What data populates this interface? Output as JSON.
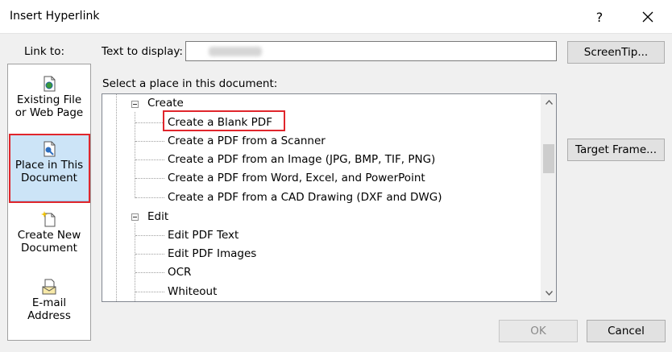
{
  "window": {
    "title": "Insert Hyperlink",
    "help_label": "?"
  },
  "link_to": {
    "label": "Link to:",
    "items": [
      {
        "label_line1": "Existing File",
        "label_line2": "or Web Page",
        "icon": "web-page-icon"
      },
      {
        "label_line1": "Place in This",
        "label_line2": "Document",
        "icon": "place-in-document-icon",
        "selected": true
      },
      {
        "label_line1": "Create New",
        "label_line2": "Document",
        "icon": "new-document-icon"
      },
      {
        "label_line1": "E-mail",
        "label_line2": "Address",
        "icon": "email-address-icon"
      }
    ]
  },
  "text_to_display": {
    "label": "Text to display:",
    "value": ""
  },
  "buttons": {
    "screentip": "ScreenTip...",
    "target_frame": "Target Frame...",
    "ok": "OK",
    "cancel": "Cancel"
  },
  "place": {
    "label": "Select a place in this document:",
    "tree": [
      {
        "text": "Create",
        "level": 0,
        "expanded": true
      },
      {
        "text": "Create a Blank PDF",
        "level": 1,
        "highlighted": true
      },
      {
        "text": "Create a PDF from a Scanner",
        "level": 1
      },
      {
        "text": "Create a PDF from an Image (JPG, BMP, TIF, PNG)",
        "level": 1
      },
      {
        "text": "Create a PDF from Word, Excel, and PowerPoint",
        "level": 1
      },
      {
        "text": "Create a PDF from a CAD Drawing (DXF and DWG)",
        "level": 1
      },
      {
        "text": "Edit",
        "level": 0,
        "expanded": true
      },
      {
        "text": "Edit PDF Text",
        "level": 1
      },
      {
        "text": "Edit PDF Images",
        "level": 1
      },
      {
        "text": "OCR",
        "level": 1
      },
      {
        "text": "Whiteout",
        "level": 1
      }
    ]
  },
  "colors": {
    "highlight_red": "#e0262c",
    "selected_bg": "#cce4f7"
  }
}
